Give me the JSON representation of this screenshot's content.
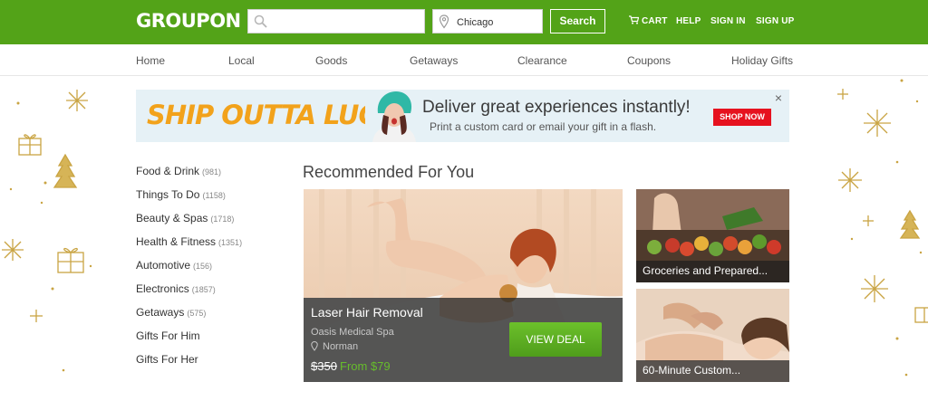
{
  "header": {
    "logo": "GROUPON",
    "search": {
      "value": "",
      "placeholder": ""
    },
    "location": {
      "value": "Chicago",
      "placeholder": ""
    },
    "search_button": "Search",
    "links": {
      "cart": "CART",
      "help": "HELP",
      "sign_in": "SIGN IN",
      "sign_up": "SIGN UP"
    },
    "brand_color": "#53a318"
  },
  "nav": {
    "items": [
      "Home",
      "Local",
      "Goods",
      "Getaways",
      "Clearance",
      "Coupons",
      "Holiday Gifts"
    ]
  },
  "banner": {
    "title": "SHIP OUTTA LUCK?",
    "headline": "Deliver great experiences instantly!",
    "subtext": "Print a custom card or email your gift in a flash.",
    "button": "SHOP NOW",
    "close": "×"
  },
  "categories": [
    {
      "label": "Food & Drink",
      "count": "(981)"
    },
    {
      "label": "Things To Do",
      "count": "(1158)"
    },
    {
      "label": "Beauty & Spas",
      "count": "(1718)"
    },
    {
      "label": "Health & Fitness",
      "count": "(1351)"
    },
    {
      "label": "Automotive",
      "count": "(156)"
    },
    {
      "label": "Electronics",
      "count": "(1857)"
    },
    {
      "label": "Getaways",
      "count": "(575)"
    },
    {
      "label": "Gifts For Him",
      "count": ""
    },
    {
      "label": "Gifts For Her",
      "count": ""
    }
  ],
  "main": {
    "section_title": "Recommended For You",
    "featured": {
      "title": "Laser Hair Removal",
      "merchant": "Oasis Medical Spa",
      "location": "Norman",
      "original_price": "$350",
      "price": "From $79",
      "button": "VIEW DEAL"
    },
    "side_deals": [
      {
        "title": "Groceries and Prepared..."
      },
      {
        "title": "60-Minute Custom..."
      }
    ]
  }
}
